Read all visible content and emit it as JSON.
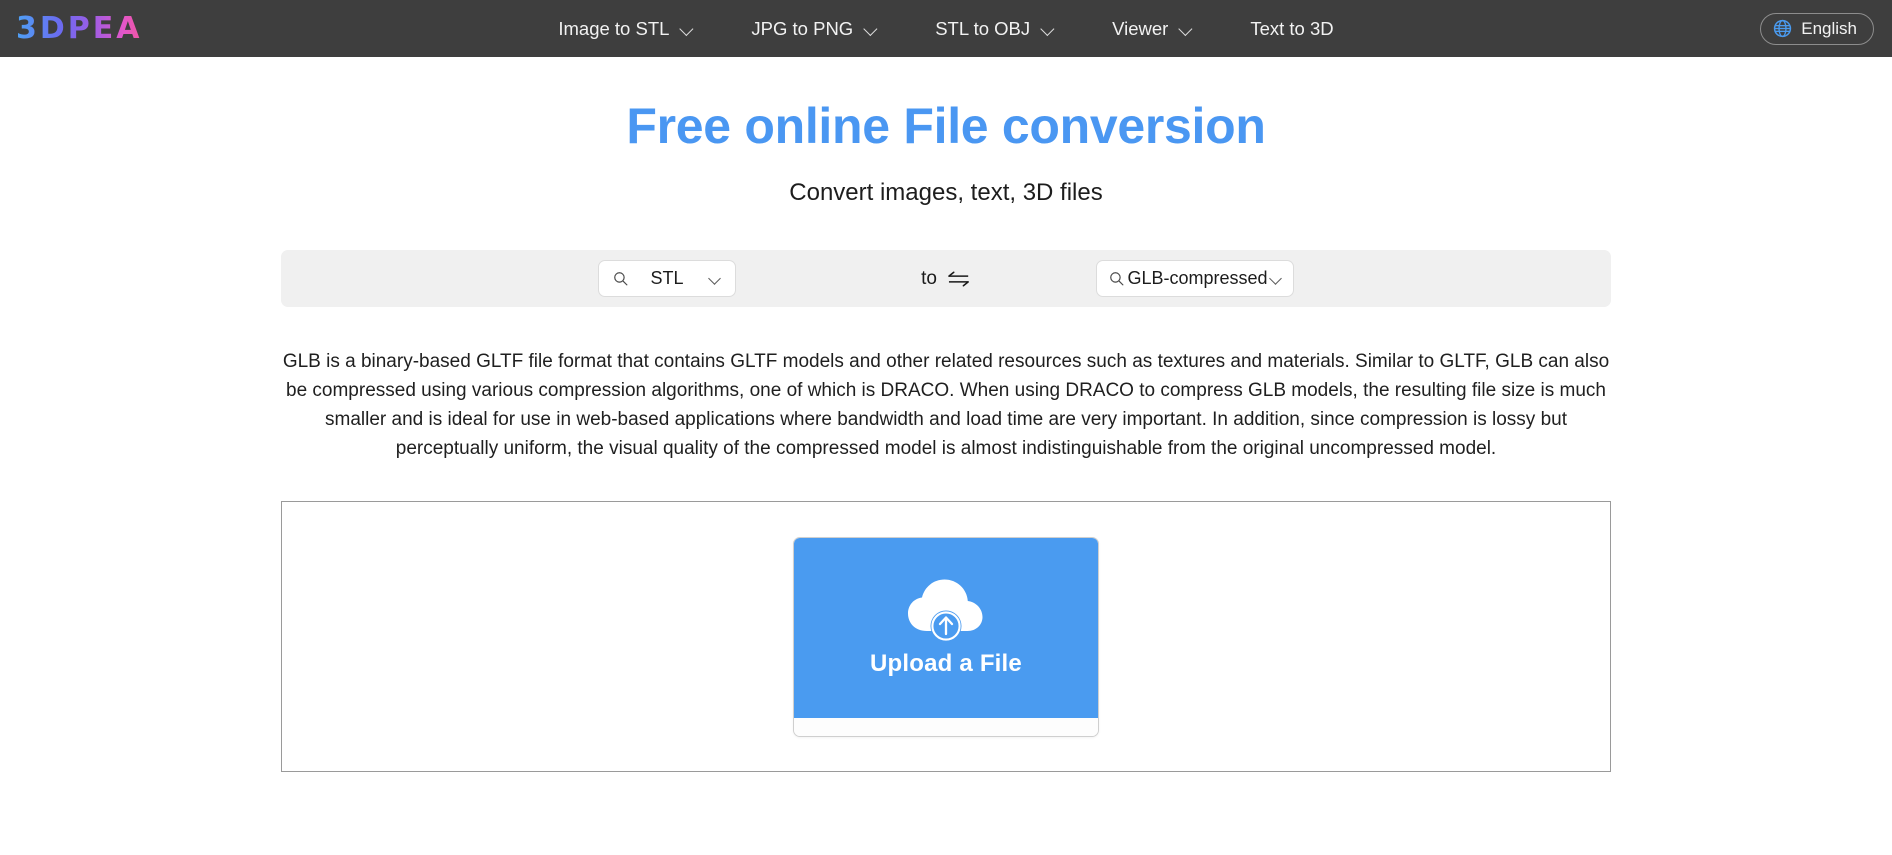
{
  "navbar": {
    "logo_text": "3DPEA",
    "items": [
      {
        "label": "Image to STL",
        "has_dropdown": true
      },
      {
        "label": "JPG to PNG",
        "has_dropdown": true
      },
      {
        "label": "STL to OBJ",
        "has_dropdown": true
      },
      {
        "label": "Viewer",
        "has_dropdown": true
      },
      {
        "label": "Text to 3D",
        "has_dropdown": false
      }
    ],
    "language": {
      "label": "English",
      "icon": "globe-icon"
    },
    "background_color": "#3e3e3e"
  },
  "hero": {
    "title": "Free online File conversion",
    "subtitle": "Convert images, text, 3D files",
    "title_color": "#4a97f2"
  },
  "converter": {
    "source": {
      "value": "STL",
      "search_icon": "search-icon",
      "chevron_icon": "chevron-down-icon"
    },
    "separator_label": "to",
    "swap_icon": "swap-arrows-icon",
    "target": {
      "value": "GLB-compressed",
      "search_icon": "search-icon",
      "chevron_icon": "chevron-down-icon"
    }
  },
  "description": {
    "text": "GLB is a binary-based GLTF file format that contains GLTF models and other related resources such as textures and materials. Similar to GLTF, GLB can also be compressed using various compression algorithms, one of which is DRACO. When using DRACO to compress GLB models, the resulting file size is much smaller and is ideal for use in web-based applications where bandwidth and load time are very important. In addition, since compression is lossy but perceptually uniform, the visual quality of the compressed model is almost indistinguishable from the original uncompressed model."
  },
  "upload": {
    "button_label": "Upload a File",
    "icon": "cloud-upload-icon",
    "button_color": "#4a9bf0"
  }
}
